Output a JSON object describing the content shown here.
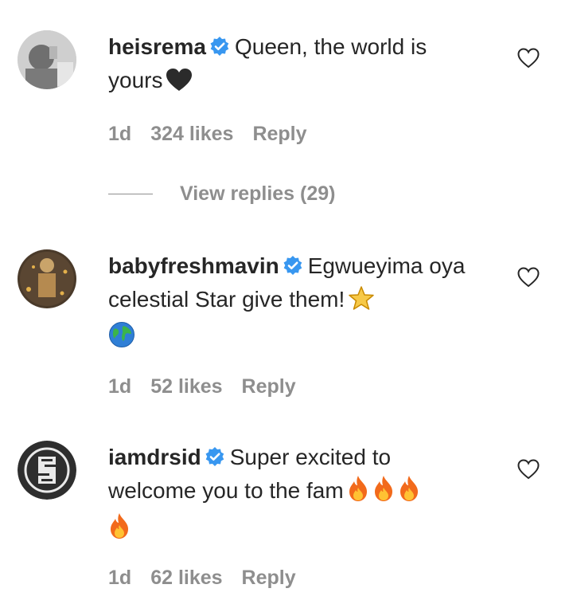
{
  "comments": [
    {
      "username": "heisrema",
      "verified": true,
      "text": "Queen, the world is yours",
      "emojis": [
        "black-heart"
      ],
      "age": "1d",
      "likes": "324 likes",
      "reply_label": "Reply",
      "view_replies": "View replies (29)"
    },
    {
      "username": "babyfreshmavin",
      "verified": true,
      "text": "Egwueyima oya celestial Star give them!",
      "emojis": [
        "star",
        "globe"
      ],
      "age": "1d",
      "likes": "52 likes",
      "reply_label": "Reply"
    },
    {
      "username": "iamdrsid",
      "verified": true,
      "text": "Super excited to welcome you to the fam",
      "emojis": [
        "fire",
        "fire",
        "fire",
        "fire"
      ],
      "age": "1d",
      "likes": "62 likes",
      "reply_label": "Reply"
    }
  ],
  "colors": {
    "text": "#262626",
    "muted": "#8e8e8e",
    "verified_blue": "#3897f0"
  }
}
